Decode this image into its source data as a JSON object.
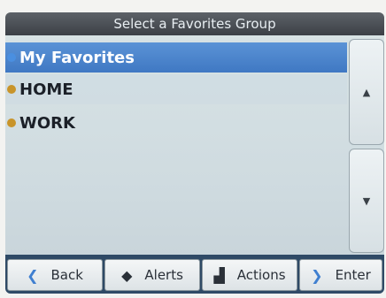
{
  "window": {
    "title": "Select a Favorites Group"
  },
  "list": {
    "items": [
      {
        "label": "My Favorites",
        "selected": true,
        "bullet_color": "#4a8fe0"
      },
      {
        "label": "HOME",
        "selected": false,
        "bullet_color": "#c8942a"
      },
      {
        "label": "WORK",
        "selected": false,
        "bullet_color": "#c8942a"
      }
    ]
  },
  "scroll": {
    "up_icon": "triangle-up",
    "down_icon": "triangle-down"
  },
  "toolbar": {
    "back_label": "Back",
    "alerts_label": "Alerts",
    "actions_label": "Actions",
    "enter_label": "Enter"
  },
  "colors": {
    "selection": "#3f78c3",
    "title_bar": "#3c4046",
    "toolbar_bg": "#2f4a66"
  }
}
